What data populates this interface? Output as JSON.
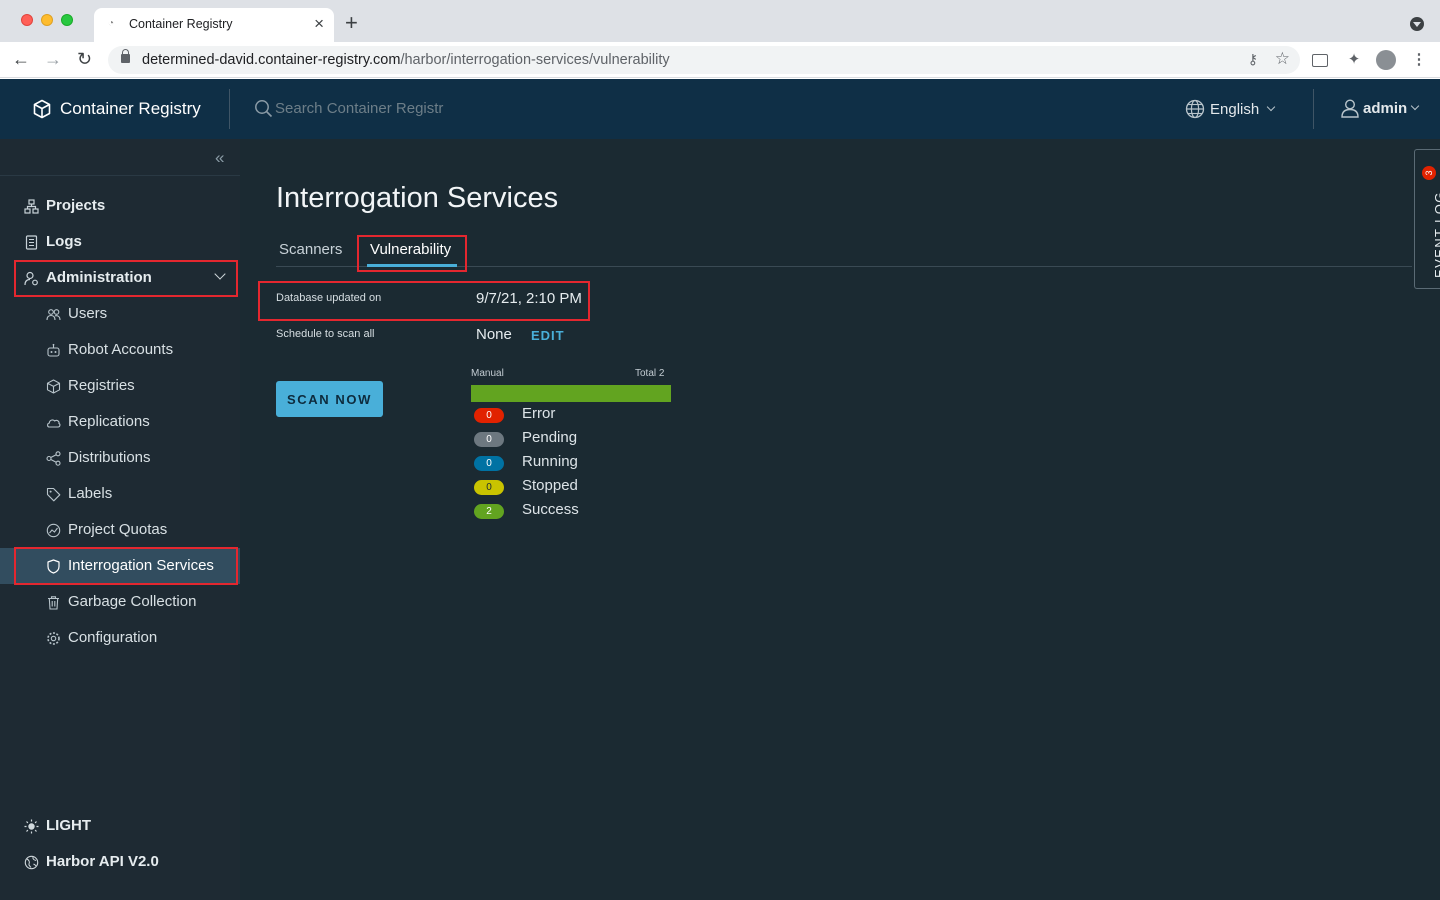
{
  "browser": {
    "tab_title": "Container Registry",
    "url_domain": "determined-david.container-registry.com",
    "url_path": "/harbor/interrogation-services/vulnerability"
  },
  "header": {
    "brand": "Container Registry",
    "search_placeholder": "Search Container Registr",
    "language": "English",
    "user": "admin"
  },
  "sidebar": {
    "items": [
      {
        "label": "Projects",
        "icon": "projects-icon"
      },
      {
        "label": "Logs",
        "icon": "logs-icon"
      },
      {
        "label": "Administration",
        "icon": "administration-icon"
      }
    ],
    "admin_items": [
      {
        "label": "Users",
        "icon": "users-icon"
      },
      {
        "label": "Robot Accounts",
        "icon": "robot-icon"
      },
      {
        "label": "Registries",
        "icon": "registries-icon"
      },
      {
        "label": "Replications",
        "icon": "replications-icon"
      },
      {
        "label": "Distributions",
        "icon": "distributions-icon"
      },
      {
        "label": "Labels",
        "icon": "labels-icon"
      },
      {
        "label": "Project Quotas",
        "icon": "quotas-icon"
      },
      {
        "label": "Interrogation Services",
        "icon": "shield-icon"
      },
      {
        "label": "Garbage Collection",
        "icon": "trash-icon"
      },
      {
        "label": "Configuration",
        "icon": "gear-icon"
      }
    ],
    "theme_toggle": "LIGHT",
    "api_link": "Harbor API V2.0"
  },
  "main": {
    "title": "Interrogation Services",
    "tabs": [
      {
        "label": "Scanners",
        "active": false
      },
      {
        "label": "Vulnerability",
        "active": true
      }
    ],
    "db_updated_label": "Database updated on",
    "db_updated_value": "9/7/21, 2:10 PM",
    "schedule_label": "Schedule to scan all",
    "schedule_value": "None",
    "edit_label": "EDIT",
    "scan_now_label": "SCAN NOW",
    "progress": {
      "trigger": "Manual",
      "total_label": "Total",
      "total": "2",
      "fill_fraction": 1.0,
      "statuses": [
        {
          "label": "Error",
          "count": "0",
          "color": "#e12200"
        },
        {
          "label": "Pending",
          "count": "0",
          "color": "#6d7880"
        },
        {
          "label": "Running",
          "count": "0",
          "color": "#0072a3"
        },
        {
          "label": "Stopped",
          "count": "0",
          "color": "#c9c300"
        },
        {
          "label": "Success",
          "count": "2",
          "color": "#62a420"
        }
      ]
    }
  },
  "event_log": {
    "label": "EVENT LOG",
    "count": "3"
  },
  "colors": {
    "accent": "#49afd9",
    "highlight": "#e4272f",
    "header_bg": "#0f2f46",
    "sidebar_bg": "#1e2a33",
    "content_bg": "#1b2a32"
  }
}
